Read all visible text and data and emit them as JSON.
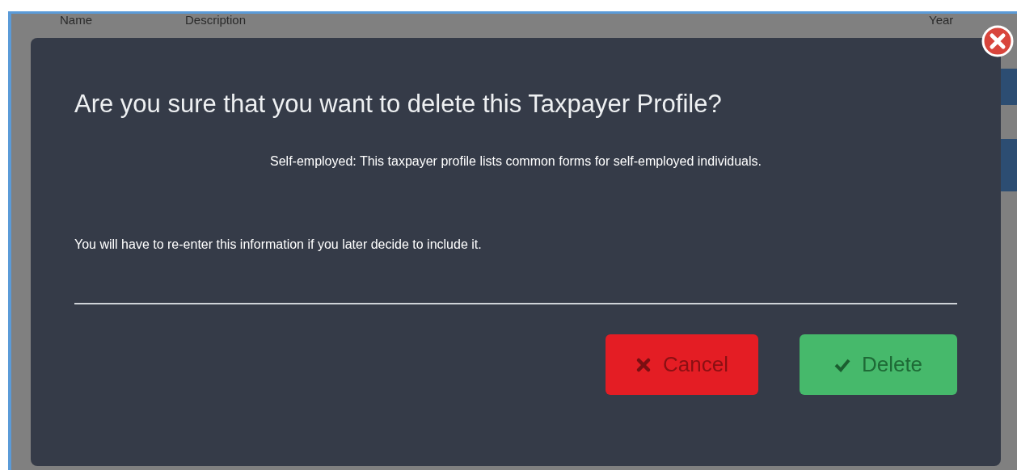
{
  "background": {
    "columns": [
      "Name",
      "Description",
      "Year"
    ]
  },
  "dialog": {
    "title": "Are you sure that you want to delete this Taxpayer Profile?",
    "message": "Self-employed: This taxpayer profile lists common forms for self-employed individuals.",
    "note": "You will have to re-enter this information if you later decide to include it.",
    "buttons": [
      {
        "label": "Cancel",
        "kind": "cancel"
      },
      {
        "label": "Delete",
        "kind": "confirm"
      }
    ]
  }
}
